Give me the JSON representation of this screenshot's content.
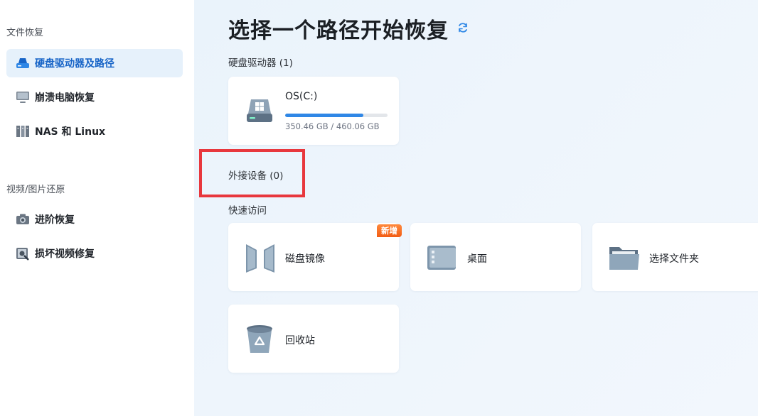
{
  "sidebar": {
    "section_file": "文件恢复",
    "items_file": [
      {
        "label": "硬盘驱动器及路径",
        "icon": "hard-drive-icon",
        "active": true
      },
      {
        "label": "崩溃电脑恢复",
        "icon": "monitor-icon",
        "active": false
      },
      {
        "label": "NAS 和 Linux",
        "icon": "nas-icon",
        "active": false
      }
    ],
    "section_media": "视频/图片还原",
    "items_media": [
      {
        "label": "进阶恢复",
        "icon": "camera-icon"
      },
      {
        "label": "损坏视频修复",
        "icon": "video-repair-icon"
      }
    ]
  },
  "main": {
    "title": "选择一个路径开始恢复",
    "drives_label": "硬盘驱动器 (1)",
    "drive": {
      "name": "OS(C:)",
      "used": "350.46 GB",
      "total": "460.06 GB",
      "size_text": "350.46 GB / 460.06 GB",
      "used_fraction": 0.762
    },
    "external_label": "外接设备 (0)",
    "quick_label": "快速访问",
    "quick_items": [
      {
        "label": "磁盘镜像",
        "icon": "disk-image-icon",
        "badge": "新增"
      },
      {
        "label": "桌面",
        "icon": "desktop-icon"
      },
      {
        "label": "选择文件夹",
        "icon": "folder-icon"
      },
      {
        "label": "回收站",
        "icon": "recycle-bin-icon"
      }
    ]
  },
  "colors": {
    "accent": "#1764c7",
    "highlight": "#e8373d",
    "badge": "#f25c14"
  }
}
